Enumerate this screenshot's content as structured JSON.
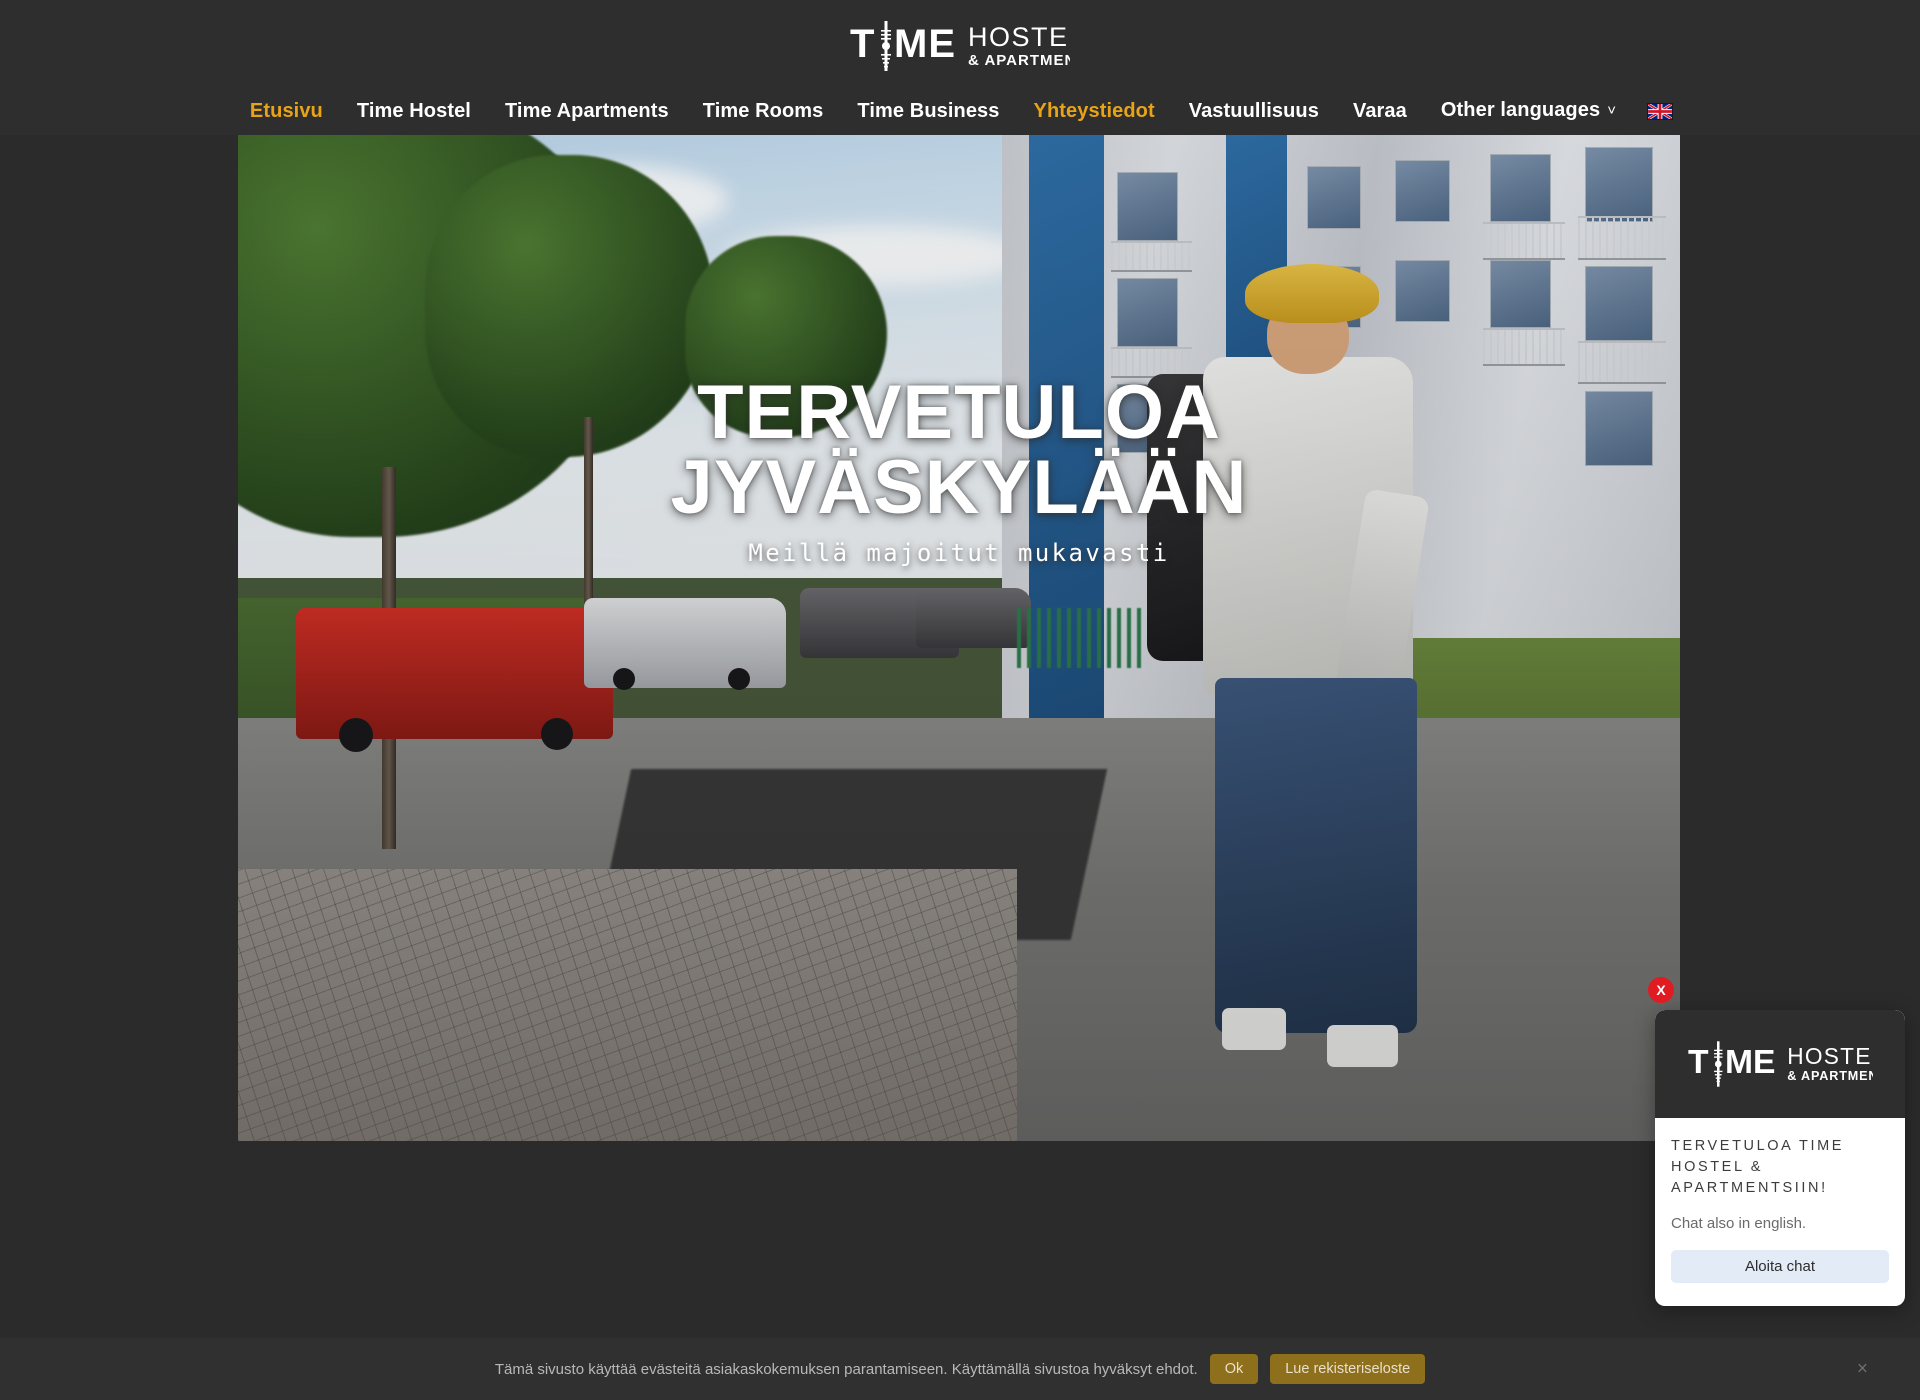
{
  "header": {
    "logo": {
      "primary": "TIME",
      "secondary": "HOSTEL",
      "tertiary": "& APARTMENTS"
    },
    "nav": [
      {
        "label": "Etusivu",
        "active": true,
        "name": "nav-etusivu"
      },
      {
        "label": "Time Hostel",
        "active": false,
        "name": "nav-time-hostel"
      },
      {
        "label": "Time Apartments",
        "active": false,
        "name": "nav-time-apartments"
      },
      {
        "label": "Time Rooms",
        "active": false,
        "name": "nav-time-rooms"
      },
      {
        "label": "Time Business",
        "active": false,
        "name": "nav-time-business"
      },
      {
        "label": "Yhteystiedot",
        "active": true,
        "name": "nav-yhteystiedot"
      },
      {
        "label": "Vastuullisuus",
        "active": false,
        "name": "nav-vastuullisuus"
      },
      {
        "label": "Varaa",
        "active": false,
        "name": "nav-varaa"
      },
      {
        "label": "Other languages",
        "active": false,
        "name": "nav-other-languages",
        "caret": "˅"
      }
    ],
    "language_flag": "uk-flag-icon"
  },
  "hero": {
    "title_line1": "TERVETULOA",
    "title_line2": "JYVÄSKYLÄÄN",
    "subtitle": "Meillä majoitut mukavasti"
  },
  "chat": {
    "close_label": "X",
    "logo": {
      "primary": "TIME",
      "secondary": "HOSTEL",
      "tertiary": "& APARTMENTS"
    },
    "title": "TERVETULOA TIME HOSTEL & APARTMENTSIIN!",
    "subtitle": "Chat also in english.",
    "button_label": "Aloita chat"
  },
  "cookie": {
    "text": "Tämä sivusto käyttää evästeitä asiakaskokemuksen parantamiseen. Käyttämällä sivustoa hyväksyt ehdot.",
    "accept_label": "Ok",
    "policy_label": "Lue rekisteriseloste",
    "close_label": "×"
  },
  "colors": {
    "accent": "#e8a317",
    "header_bg": "#2e2e2e",
    "page_bg": "#2b2b2b",
    "cookie_bg": "#303030",
    "cookie_btn": "#8e6f1c",
    "chat_btn": "#e3ebf7",
    "close_red": "#e01b22"
  }
}
